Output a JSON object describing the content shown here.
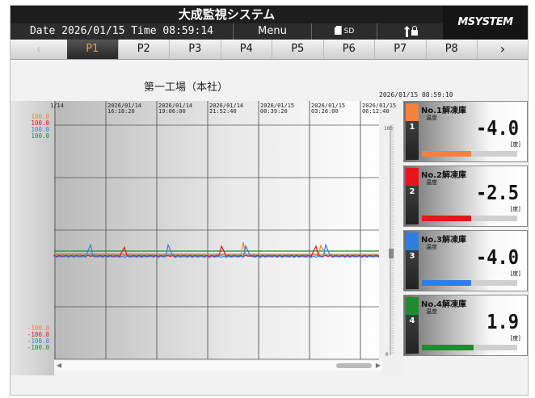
{
  "header": {
    "title": "大成監視システム",
    "brand": "MSYSTEM",
    "date_label": "Date",
    "date": "2026/01/15",
    "time_label": "Time",
    "time": "08:59:14",
    "menu_label": "Menu",
    "sd_label": "SD"
  },
  "tabs": [
    {
      "label": "P1",
      "active": true
    },
    {
      "label": "P2"
    },
    {
      "label": "P3"
    },
    {
      "label": "P4"
    },
    {
      "label": "P5"
    },
    {
      "label": "P6"
    },
    {
      "label": "P7"
    },
    {
      "label": "P8"
    }
  ],
  "nav": {
    "prev": "‹",
    "next": "›"
  },
  "chart": {
    "title": "第一工場（本社）",
    "clock": "2026/01/15 08:59:10",
    "left_scale_top": [
      "100.0",
      "100.0",
      "100.0",
      "100.0"
    ],
    "left_scale_bottom": [
      "-100.0",
      "-100.0",
      "-100.0",
      "-100.0"
    ],
    "right_scale_top": "100",
    "right_scale_bottom": "0",
    "time_labels": [
      {
        "d": "1/14",
        "t": ""
      },
      {
        "d": "2026/01/14",
        "t": "16:18:20"
      },
      {
        "d": "2026/01/14",
        "t": "19:06:00"
      },
      {
        "d": "2026/01/14",
        "t": "21:52:40"
      },
      {
        "d": "2026/01/15",
        "t": "00:39:20"
      },
      {
        "d": "2026/01/15",
        "t": "03:26:00"
      },
      {
        "d": "2026/01/15",
        "t": "06:12:40"
      }
    ]
  },
  "channels": [
    {
      "name": "No.1解凍庫",
      "label": "温度",
      "value": "-4.0",
      "unit": "[度]",
      "color": "#f5823a",
      "num": "1",
      "bar": 0.52
    },
    {
      "name": "No.2解凍庫",
      "label": "温度",
      "value": "-2.5",
      "unit": "[度]",
      "color": "#e8141b",
      "num": "2",
      "bar": 0.52
    },
    {
      "name": "No.3解凍庫",
      "label": "温度",
      "value": "-4.0",
      "unit": "[度]",
      "color": "#2f7fe0",
      "num": "3",
      "bar": 0.52
    },
    {
      "name": "No.4解凍庫",
      "label": "温度",
      "value": "1.9",
      "unit": "[度]",
      "color": "#1e8c2f",
      "num": "4",
      "bar": 0.54
    }
  ],
  "colors": {
    "ch1": "#f5823a",
    "ch2": "#e8141b",
    "ch3": "#2f7fe0",
    "ch4": "#1e8c2f"
  }
}
